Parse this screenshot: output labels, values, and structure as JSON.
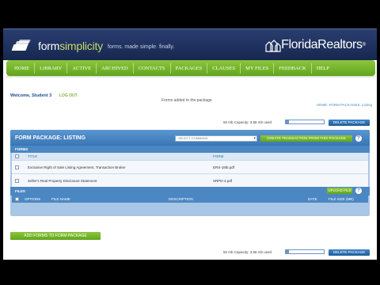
{
  "header": {
    "logo_name_a": "form",
    "logo_name_b": "simplicity",
    "tagline": "forms. made simple. finally.",
    "partner_logo": "FloridaRealtors"
  },
  "nav": {
    "items": [
      "HOME",
      "LIBRARY",
      "ACTIVE",
      "ARCHIVED",
      "CONTACTS",
      "PACKAGES",
      "CLAUSES",
      "MY FILES",
      "FEEDBACK",
      "HELP"
    ]
  },
  "user": {
    "welcome": "Welcome, Student 3",
    "logout": "LOG OUT"
  },
  "notice": "Forms added to the package",
  "breadcrumb": "HOME: FORM PACKAGES: Listing",
  "capacity_top": {
    "label": "50 mb Capacity: 3.88 mb used",
    "used_fraction": 0.078,
    "button": "DELETE PACKAGE"
  },
  "package": {
    "title": "FORM PACKAGE: LISTING",
    "command_placeholder": "SELECT COMMAND",
    "create_button": "CREATE TRANSACTION FROM THIS PACKAGE",
    "help_icon": "?",
    "forms": {
      "label": "FORMS",
      "columns": [
        "TITLE",
        "FORM"
      ],
      "rows": [
        {
          "title": "Exclusive Right of Sale Listing Agreement, Transaction Broker",
          "form": "ERS-18tb.pdf"
        },
        {
          "title": "Seller's Real Property Disclosure Statement",
          "form": "SRPD-4.pdf"
        }
      ],
      "upload_button": "UPLOAD FILE"
    },
    "files": {
      "label": "FILES",
      "columns": [
        "OPTIONS",
        "FILE NAME",
        "DESCRIPTION",
        "DATE",
        "FILE SIZE (MB)"
      ]
    }
  },
  "add_forms_button": "ADD FORMS TO FORM PACKAGE",
  "capacity_bottom": {
    "label": "50 mb Capacity: 3.88 mb used",
    "used_fraction": 0.078,
    "button": "DELETE PACKAGE"
  },
  "colors": {
    "nav_green": "#74b52c",
    "header_navy": "#1f3262",
    "panel_blue": "#4b87c3"
  }
}
